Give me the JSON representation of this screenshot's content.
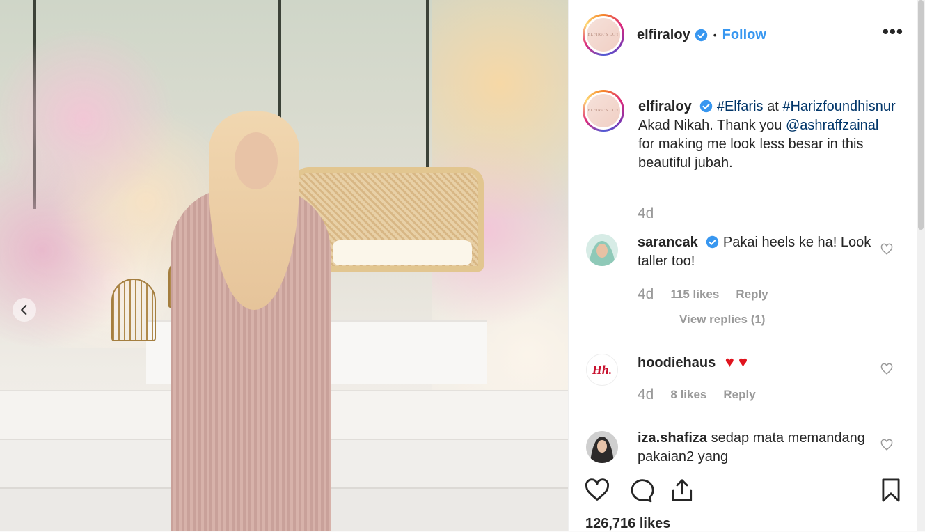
{
  "post": {
    "author": "elfiraloy",
    "follow_label": "Follow",
    "separator": "•",
    "more_label": "•••",
    "avatar_text": "ELFIRA'S LOY",
    "caption": {
      "author": "elfiraloy",
      "parts": [
        {
          "type": "tag",
          "text": "#Elfaris"
        },
        {
          "type": "text",
          "text": " at "
        },
        {
          "type": "tag",
          "text": "#Harizfoundhisnur"
        },
        {
          "type": "text",
          "text": " Akad Nikah. Thank you "
        },
        {
          "type": "tag",
          "text": "@ashraffzainal"
        },
        {
          "type": "text",
          "text": " for making me look less besar in this beautiful jubah."
        }
      ],
      "time": "4d"
    },
    "likes": "126,716 likes"
  },
  "comments": [
    {
      "user": "sarancak",
      "verified": true,
      "text": "Pakai heels ke ha! Look taller too!",
      "time": "4d",
      "likes": "115 likes",
      "reply": "Reply",
      "view_replies": "View replies (1)"
    },
    {
      "user": "hoodiehaus",
      "verified": false,
      "text": "♥ ♥",
      "time": "4d",
      "likes": "8 likes",
      "reply": "Reply",
      "avatar_text": "Hh."
    },
    {
      "user": "iza.shafiza",
      "verified": false,
      "text": "sedap mata memandang pakaian2 yang"
    }
  ],
  "colors": {
    "accent": "#3897f0",
    "verified": "#3897f0",
    "tag": "#003569",
    "heart_red": "#ed4956"
  },
  "icons": [
    "chevron-left-icon",
    "verified-icon",
    "more-icon",
    "heart-icon",
    "comment-icon",
    "share-icon",
    "bookmark-icon"
  ]
}
